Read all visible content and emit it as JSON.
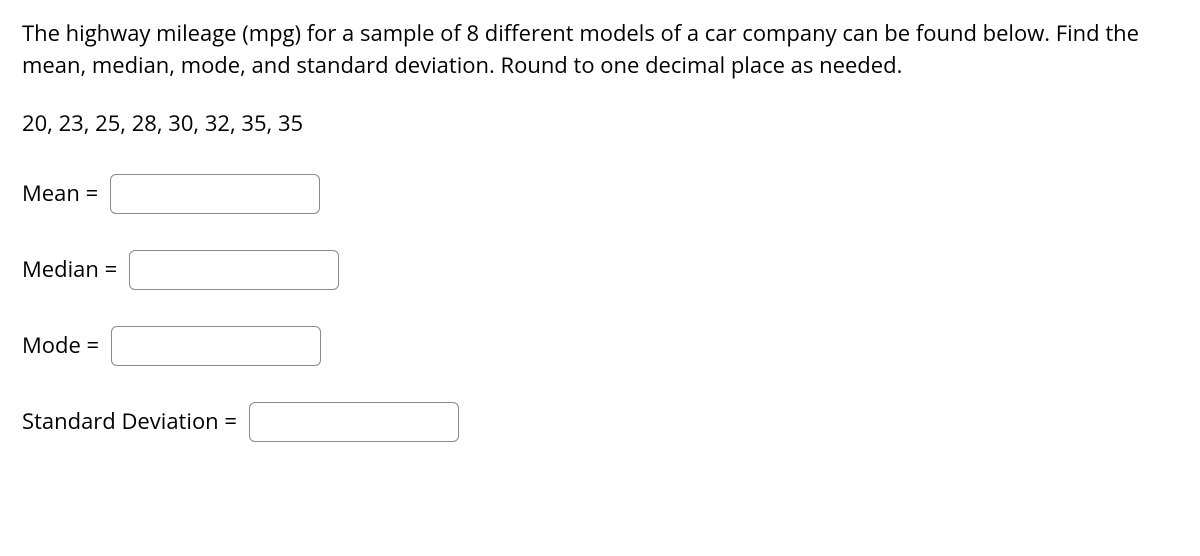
{
  "question": {
    "prompt": "The highway mileage (mpg) for a sample of 8 different models of a car company can be found below. Find the mean, median, mode, and standard deviation. Round to one decimal place as needed.",
    "data_values": "20, 23, 25, 28, 30, 32, 35, 35"
  },
  "answers": {
    "mean": {
      "label": "Mean = ",
      "value": ""
    },
    "median": {
      "label": "Median = ",
      "value": ""
    },
    "mode": {
      "label": "Mode = ",
      "value": ""
    },
    "std_dev": {
      "label": "Standard Deviation = ",
      "value": ""
    }
  }
}
